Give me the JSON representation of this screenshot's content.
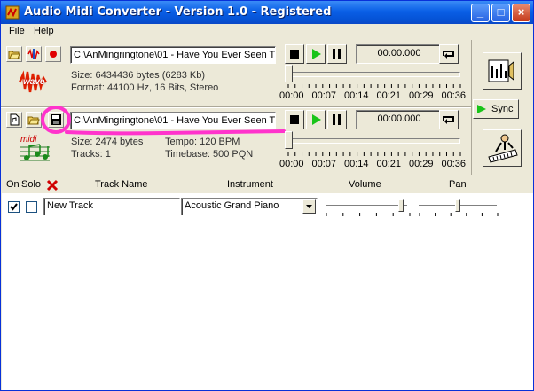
{
  "window": {
    "title": "Audio Midi Converter - Version 1.0 - Registered",
    "minimize_glyph": "_",
    "maximize_glyph": "□",
    "close_glyph": "×"
  },
  "menu": {
    "items": [
      {
        "label": "File"
      },
      {
        "label": "Help"
      }
    ]
  },
  "wave_panel": {
    "badge": "wave",
    "path": "C:\\AnMingringtone\\01 - Have You Ever Seen T",
    "time": "00:00.000",
    "size": "Size: 6434436 bytes (6283 Kb)",
    "format": "Format: 44100 Hz, 16 Bits, Stereo",
    "ticks": [
      "00:00",
      "00:07",
      "00:14",
      "00:21",
      "00:29",
      "00:36"
    ],
    "position_fraction": 0
  },
  "midi_panel": {
    "badge": "midi",
    "path": "C:\\AnMingringtone\\01 - Have You Ever Seen T",
    "time": "00:00.000",
    "size": "Size: 2474 bytes",
    "tracks": "Tracks: 1",
    "tempo": "Tempo: 120 BPM",
    "timebase": "Timebase: 500 PQN",
    "ticks": [
      "00:00",
      "00:07",
      "00:14",
      "00:21",
      "00:29",
      "00:36"
    ],
    "position_fraction": 0
  },
  "sync_label": "Sync",
  "track_header": {
    "on": "On",
    "solo": "Solo",
    "name": "Track Name",
    "instrument": "Instrument",
    "volume": "Volume",
    "pan": "Pan"
  },
  "tracks": [
    {
      "on": true,
      "solo": false,
      "name": "New Track",
      "instrument": "Acoustic Grand Piano",
      "volume_fraction": 0.95,
      "pan_fraction": 0.5
    }
  ],
  "colors": {
    "highlight_annotation": "#ff33cc",
    "play_green": "#19c419",
    "record_red": "#e00000",
    "title_blue": "#0a5fe6"
  }
}
